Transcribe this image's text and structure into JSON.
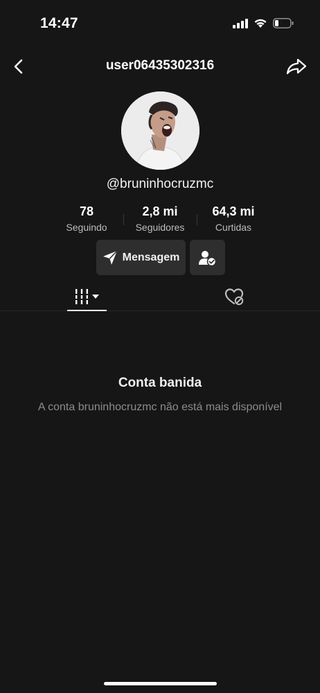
{
  "status_bar": {
    "time": "14:47",
    "icons": [
      "signal-icon",
      "wifi-icon",
      "battery-icon"
    ]
  },
  "header": {
    "title": "user06435302316",
    "back_icon": "chevron-left-icon",
    "share_icon": "share-icon"
  },
  "profile": {
    "avatar": "profile-photo",
    "handle": "@bruninhocruzmc",
    "stats": [
      {
        "value": "78",
        "label": "Seguindo"
      },
      {
        "value": "2,8 mi",
        "label": "Seguidores"
      },
      {
        "value": "64,3 mi",
        "label": "Curtidas"
      }
    ]
  },
  "actions": {
    "message_label": "Mensagem",
    "message_icon": "send-icon",
    "follow_icon": "user-check-icon"
  },
  "tabs": {
    "videos_icon": "grid-icon",
    "liked_icon": "heart-hidden-icon"
  },
  "empty_state": {
    "title": "Conta banida",
    "description": "A conta bruninhocruzmc não está mais disponível"
  },
  "colors": {
    "background": "#161616",
    "button_bg": "#2e2e2e",
    "text_secondary": "#8c8c8c"
  }
}
